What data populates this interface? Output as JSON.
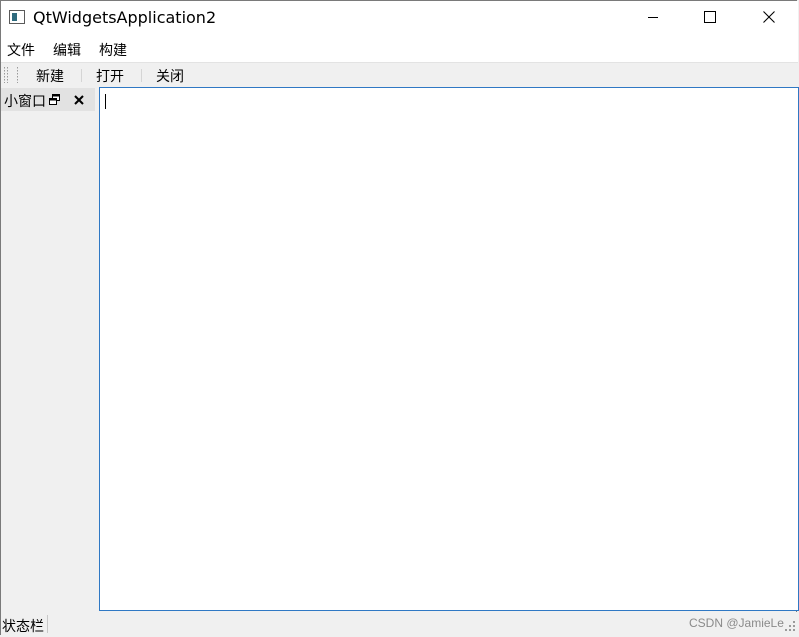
{
  "window": {
    "title": "QtWidgetsApplication2"
  },
  "menubar": {
    "items": [
      "文件",
      "编辑",
      "构建"
    ]
  },
  "toolbar": {
    "actions": [
      "新建",
      "打开",
      "关闭"
    ]
  },
  "dock": {
    "title": "小窗口"
  },
  "editor": {
    "text": ""
  },
  "statusbar": {
    "message": "状态栏",
    "watermark": "CSDN @JamieLe"
  },
  "colors": {
    "editor_border": "#2f78c4",
    "window_bg": "#f0f0f0"
  }
}
